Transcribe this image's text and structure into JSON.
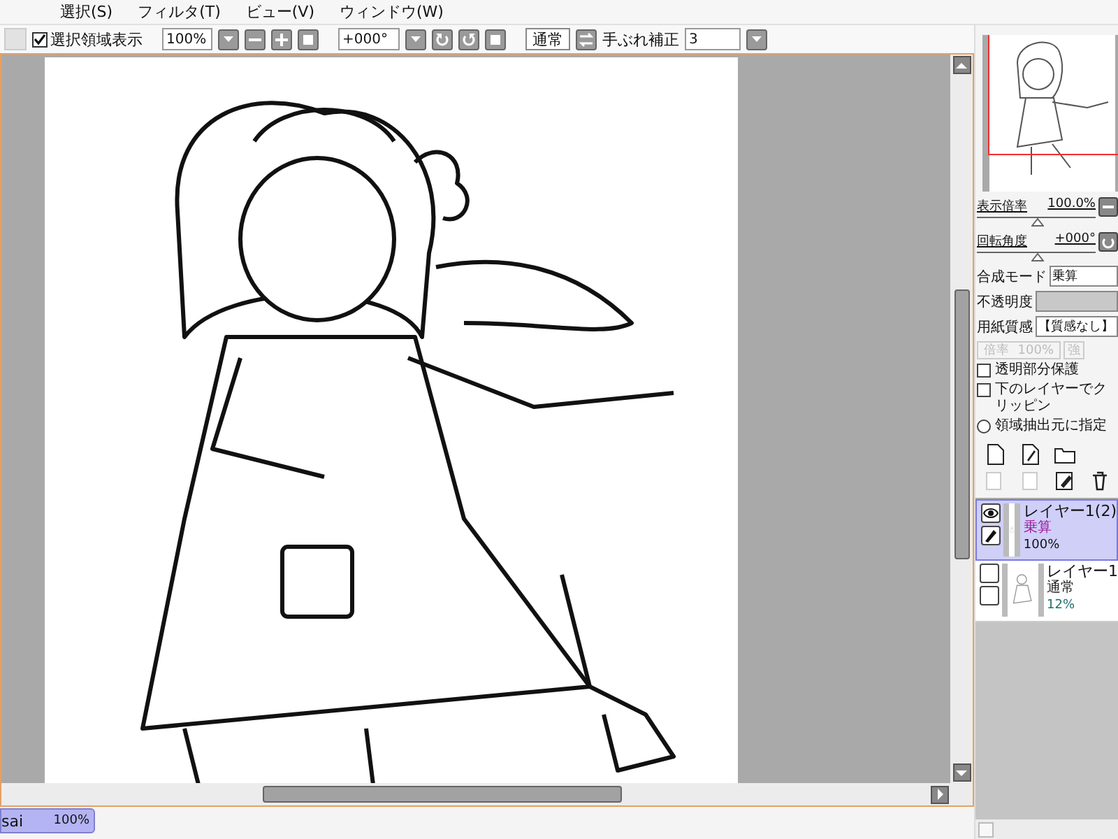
{
  "menu": [
    "選択(S)",
    "フィルタ(T)",
    "ビュー(V)",
    "ウィンドウ(W)"
  ],
  "toolbar": {
    "selection_visible": {
      "label": "選択領域表示",
      "checked": true
    },
    "zoom": "100%",
    "rotation": "+000°",
    "blend": "通常",
    "stabilizer_label": "手ぶれ補正",
    "stabilizer": "3"
  },
  "navigator": {
    "zoom_label": "表示倍率",
    "zoom_value": "100.0%",
    "zoom_slider": {
      "level": 0.5
    },
    "rotate_label": "回転角度",
    "rotate_value": "+000°",
    "rotate_slider": {
      "level": 0.5
    }
  },
  "layer_props": {
    "blend_mode_label": "合成モード",
    "blend_mode": "乗算",
    "opacity_label": "不透明度",
    "opacity_slider": {
      "level": 1
    },
    "paper_label": "用紙質感",
    "paper": "【質感なし】",
    "scale_label": "倍率",
    "scale_value": "100%",
    "strength_label": "強"
  },
  "options": [
    {
      "kind": "checkbox",
      "label": "透明部分保護",
      "checked": false
    },
    {
      "kind": "checkbox",
      "label": "下のレイヤーでクリッピン",
      "checked": false
    },
    {
      "kind": "radio",
      "label": "領域抽出元に指定",
      "checked": false
    }
  ],
  "layers": [
    {
      "name": "レイヤー1(2)",
      "mode": "乗算",
      "color": "#a020a0",
      "opacity": "100%",
      "selected": true,
      "visible": true
    },
    {
      "name": "レイヤー1",
      "mode": "通常",
      "color": "#222222",
      "opacity": "12%",
      "selected": false,
      "visible": false
    }
  ],
  "documents": [
    {
      "name": "sai",
      "zoom": "100%",
      "selected": true
    }
  ]
}
